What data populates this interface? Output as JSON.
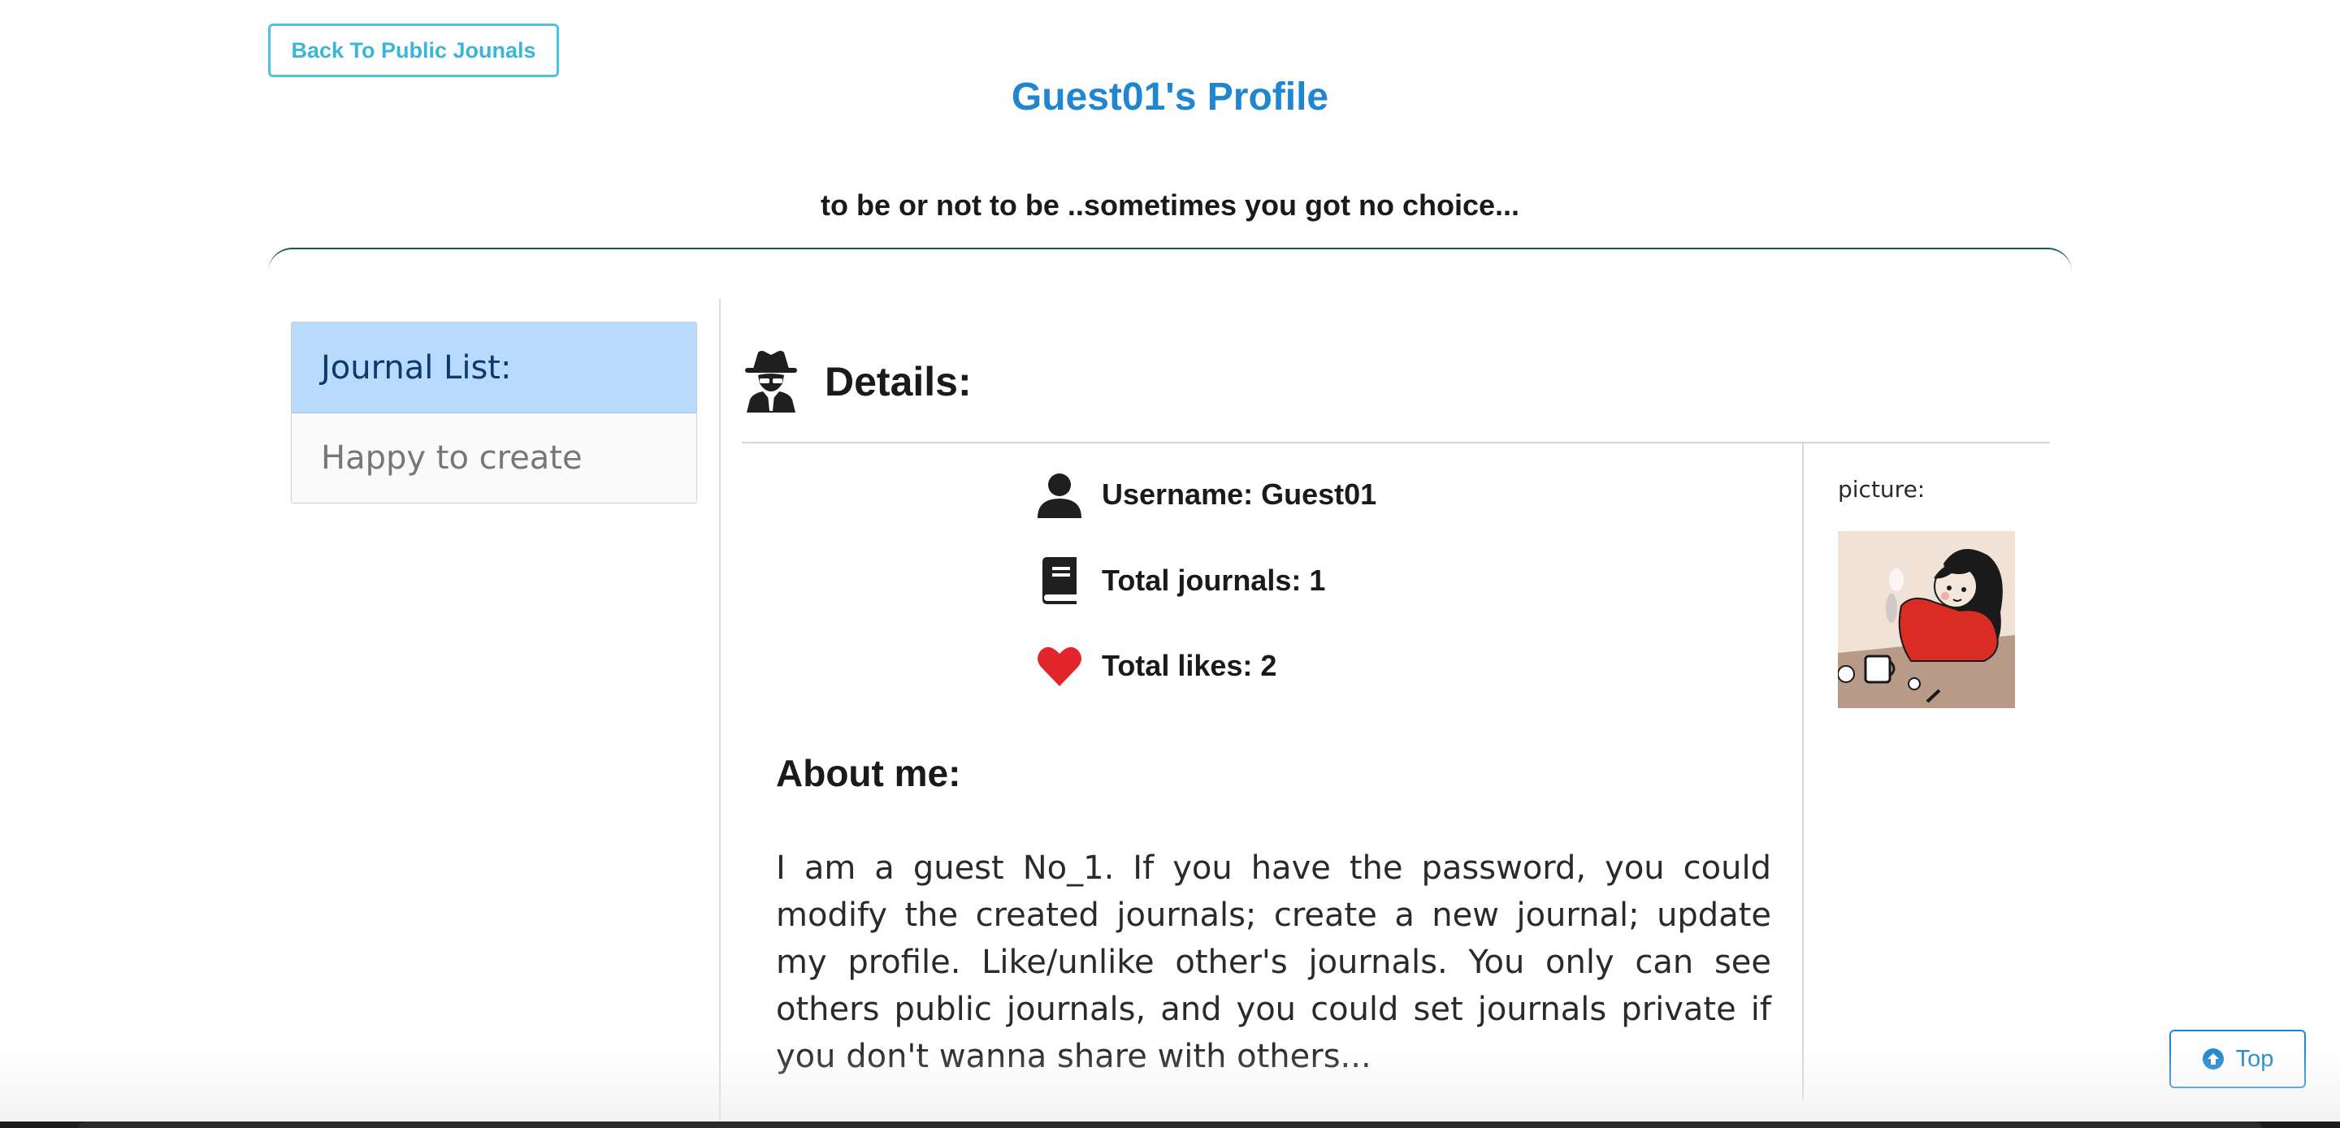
{
  "header": {
    "back_label": "Back To Public Jounals",
    "title": "Guest01's Profile",
    "motto": "to be or not to be ..sometimes you got no choice..."
  },
  "sidebar": {
    "heading": "Journal List:",
    "items": [
      {
        "label": "Happy to create"
      }
    ]
  },
  "details": {
    "heading": "Details:",
    "username": "Username: Guest01",
    "total_journals": "Total journals: 1",
    "total_likes": "Total likes: 2",
    "about_heading": "About me:",
    "about_text": "I am a guest No_1. If you have the password, you could modify the created journals; create a new journal; update my profile. Like/unlike other's journals. You only can see others public journals, and you could set journals private if you don't wanna share with others...",
    "picture_label": "picture:"
  },
  "footer": {
    "top_label": "Top"
  },
  "colors": {
    "accent": "#1f86cf",
    "back_button": "#4ec3e0",
    "list_header_bg": "#b8dafc",
    "heart": "#e0262b"
  },
  "icons": {
    "details": "spy-icon",
    "username": "user-icon",
    "journals": "book-icon",
    "likes": "heart-icon",
    "top": "arrow-up-circle-icon"
  }
}
